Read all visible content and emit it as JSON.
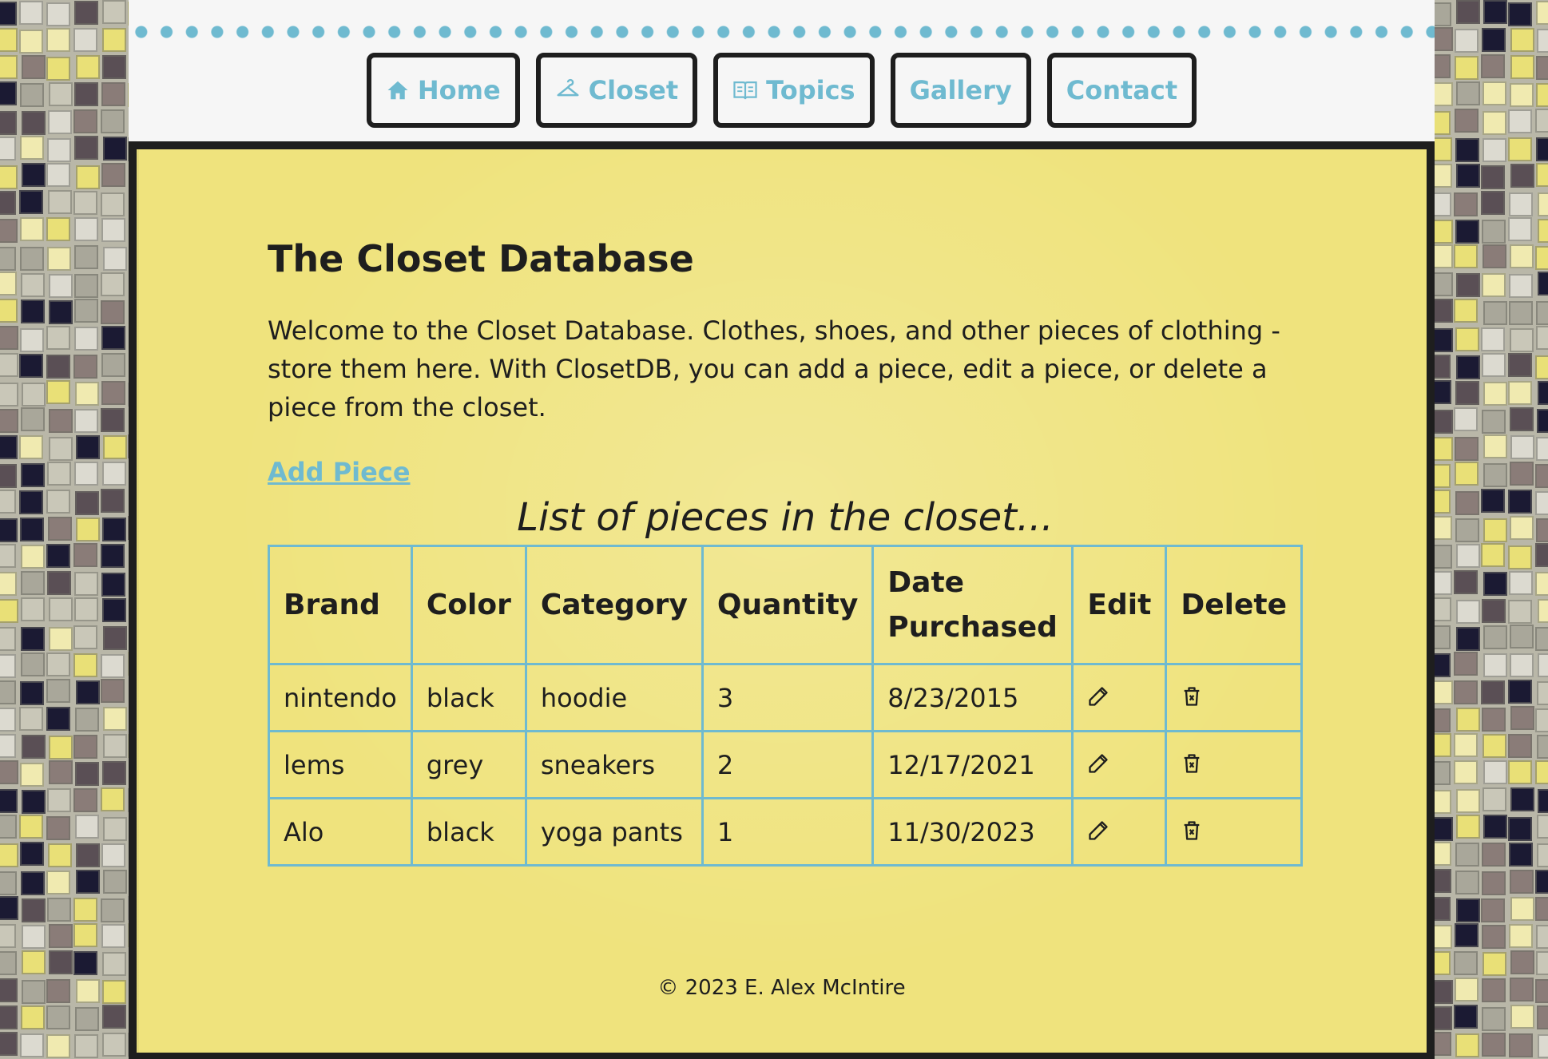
{
  "nav": {
    "items": [
      {
        "label": "Home",
        "icon": "home-icon"
      },
      {
        "label": "Closet",
        "icon": "hanger-icon"
      },
      {
        "label": "Topics",
        "icon": "book-icon"
      },
      {
        "label": "Gallery",
        "icon": ""
      },
      {
        "label": "Contact",
        "icon": ""
      }
    ]
  },
  "main": {
    "title": "The Closet Database",
    "intro": "Welcome to the Closet Database. Clothes, shoes, and other pieces of clothing - store them here. With ClosetDB, you can add a piece, edit a piece, or delete a piece from the closet.",
    "add_link": "Add Piece",
    "caption": "List of pieces in the closet...",
    "table": {
      "headers": [
        "Brand",
        "Color",
        "Category",
        "Quantity",
        "Date Purchased",
        "Edit",
        "Delete"
      ],
      "rows": [
        {
          "brand": "nintendo",
          "color": "black",
          "category": "hoodie",
          "quantity": "3",
          "date": "8/23/2015"
        },
        {
          "brand": "lems",
          "color": "grey",
          "category": "sneakers",
          "quantity": "2",
          "date": "12/17/2021"
        },
        {
          "brand": "Alo",
          "color": "black",
          "category": "yoga pants",
          "quantity": "1",
          "date": "11/30/2023"
        }
      ]
    }
  },
  "footer": {
    "copyright": "© 2023 E. Alex McIntire"
  },
  "colors": {
    "accent": "#6fbad0",
    "panel": "#efe37d",
    "border": "#1e1e1e",
    "header_bg": "#f6f6f6"
  }
}
